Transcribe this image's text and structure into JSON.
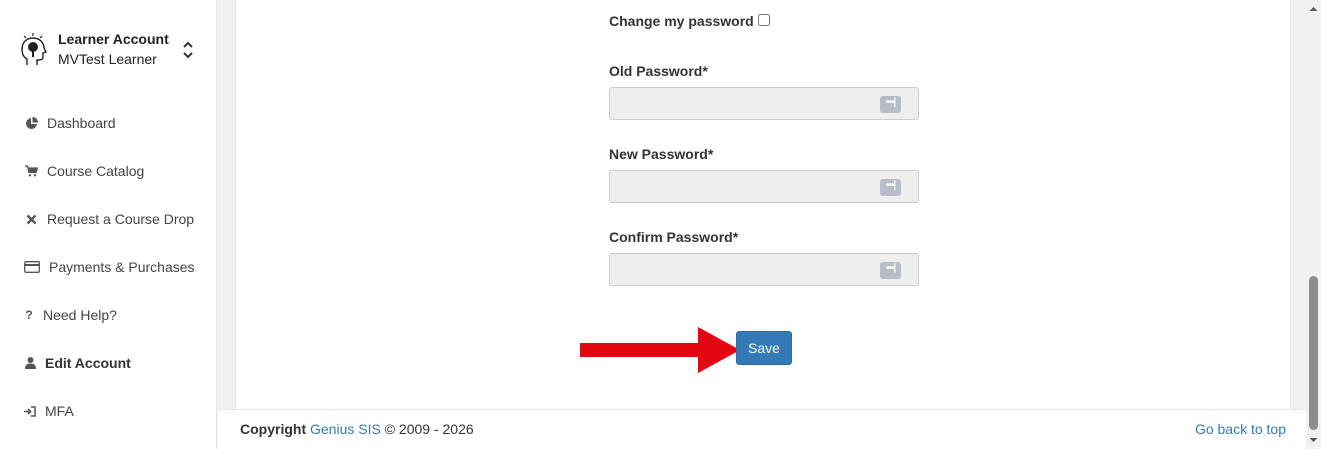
{
  "sidebar": {
    "account": {
      "title": "Learner Account",
      "name": "MVTest Learner",
      "logo_icon": "head-tree-icon",
      "switch_icon": "chevron-up-down-icon"
    },
    "items": [
      {
        "label": "Dashboard",
        "icon": "pie-chart-icon",
        "glyph": "◔"
      },
      {
        "label": "Course Catalog",
        "icon": "cart-icon",
        "glyph": "🛒"
      },
      {
        "label": "Request a Course Drop",
        "icon": "close-icon",
        "glyph": "✖"
      },
      {
        "label": "Payments & Purchases",
        "icon": "credit-card-icon",
        "glyph": "▭"
      },
      {
        "label": "Need Help?",
        "icon": "question-icon",
        "glyph": "?"
      },
      {
        "label": "Edit Account",
        "icon": "user-icon",
        "glyph": "●",
        "active": true
      },
      {
        "label": "MFA",
        "icon": "sign-in-icon",
        "glyph": "⇥"
      }
    ]
  },
  "form": {
    "change_password_label": "Change my password",
    "old_password_label": "Old Password*",
    "new_password_label": "New Password*",
    "confirm_password_label": "Confirm Password*",
    "old_password_value": "",
    "new_password_value": "",
    "confirm_password_value": "",
    "password_manager_icon": "password-dots-icon",
    "save_label": "Save"
  },
  "footer": {
    "copyright_prefix": "Copyright",
    "brand_link": "Genius SIS",
    "copyright_suffix": "© 2009 - 2026",
    "back_to_top": "Go back to top"
  },
  "colors": {
    "accent": "#337ab7",
    "arrow": "#e30613",
    "input_bg": "#eeeeee"
  }
}
